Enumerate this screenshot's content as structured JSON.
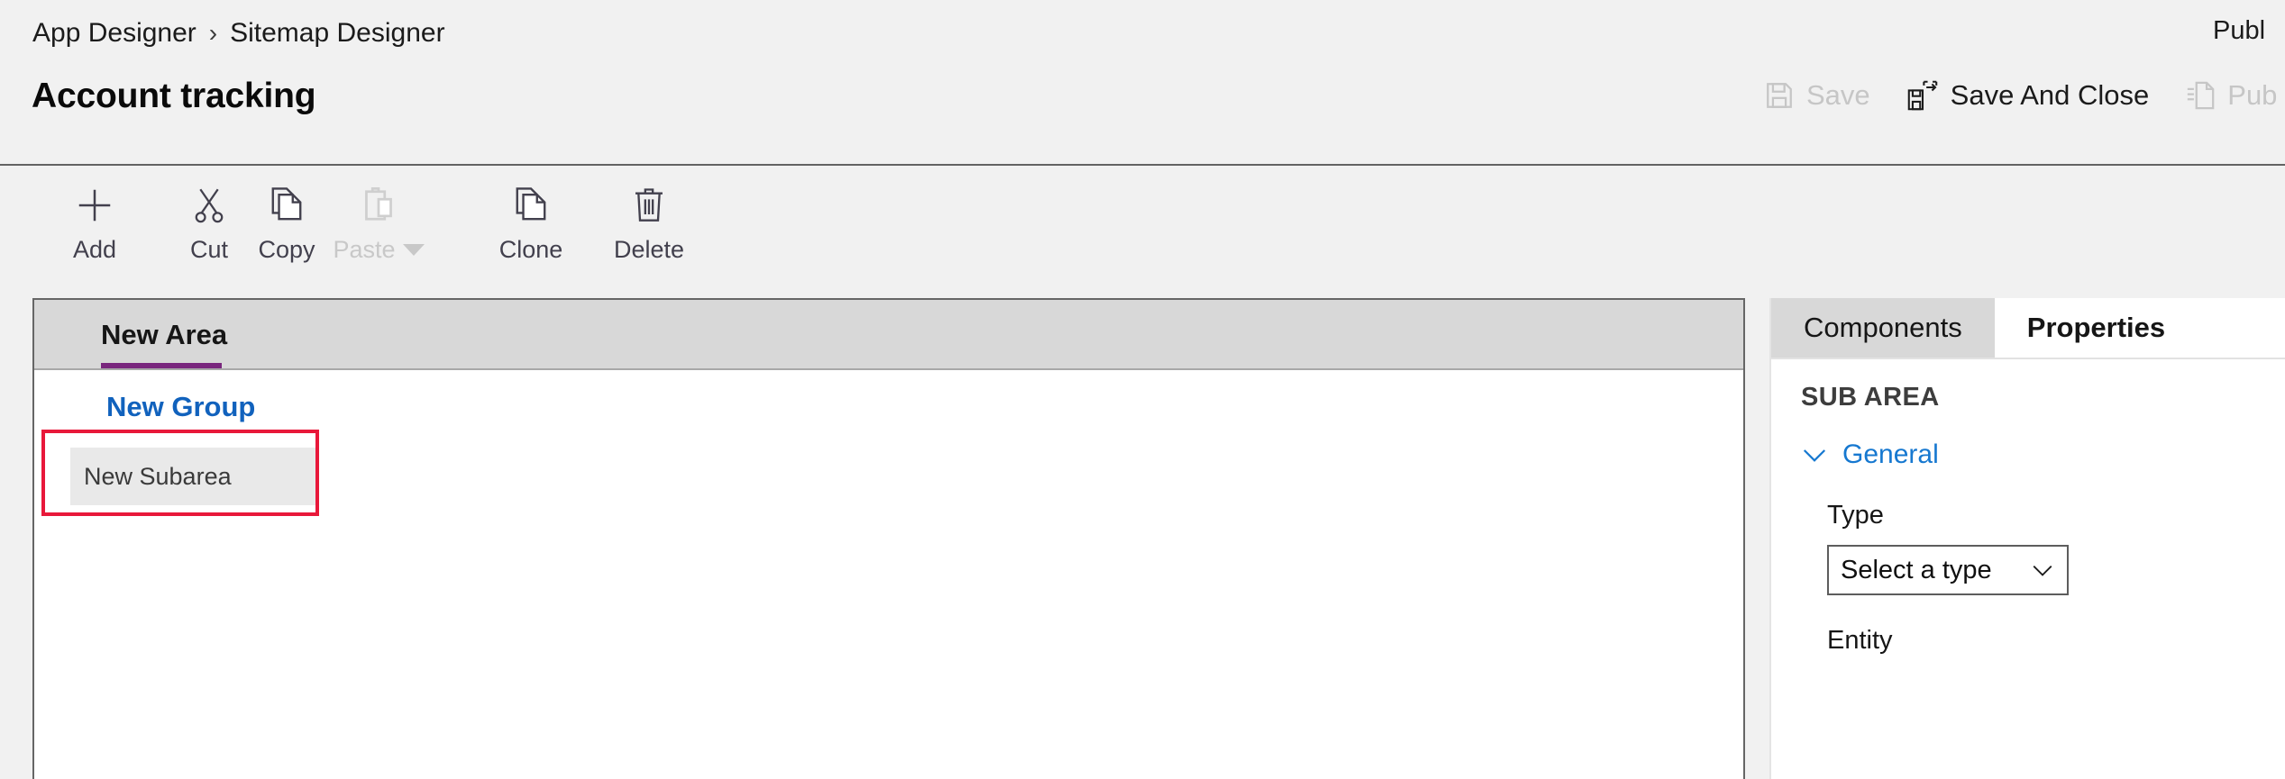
{
  "header": {
    "breadcrumb": [
      {
        "label": "App Designer"
      },
      {
        "label": "Sitemap Designer"
      }
    ],
    "breadcrumb_separator": "›",
    "title": "Account tracking",
    "status_text": "Publ",
    "actions": [
      {
        "label": "Save",
        "icon": "save-icon",
        "disabled": true
      },
      {
        "label": "Save And Close",
        "icon": "save-and-close-icon",
        "disabled": false
      },
      {
        "label": "Pub",
        "icon": "publish-icon",
        "disabled": true
      }
    ]
  },
  "toolbar": {
    "items": [
      {
        "label": "Add",
        "icon": "plus-icon",
        "disabled": false,
        "dropdown": false
      },
      {
        "label": "Cut",
        "icon": "scissors-icon",
        "disabled": false,
        "dropdown": false
      },
      {
        "label": "Copy",
        "icon": "copy-icon",
        "disabled": false,
        "dropdown": false
      },
      {
        "label": "Paste",
        "icon": "clipboard-icon",
        "disabled": true,
        "dropdown": true
      },
      {
        "label": "Clone",
        "icon": "clone-icon",
        "disabled": false,
        "dropdown": false
      },
      {
        "label": "Delete",
        "icon": "trash-icon",
        "disabled": false,
        "dropdown": false
      }
    ]
  },
  "canvas": {
    "area_tab": "New Area",
    "group_title": "New Group",
    "subarea_label": "New Subarea",
    "selection_color": "#e8183a",
    "tab_indicator_color": "#79267d",
    "group_link_color": "#1162bd"
  },
  "panel": {
    "tabs": [
      {
        "label": "Components",
        "active": false
      },
      {
        "label": "Properties",
        "active": true
      }
    ],
    "section_title": "SUB AREA",
    "group": {
      "label": "General",
      "expanded": true,
      "color": "#1678d0"
    },
    "fields": [
      {
        "label": "Type",
        "value": "Select a type",
        "control": "select"
      },
      {
        "label": "Entity",
        "value": "",
        "control": "select"
      }
    ]
  }
}
